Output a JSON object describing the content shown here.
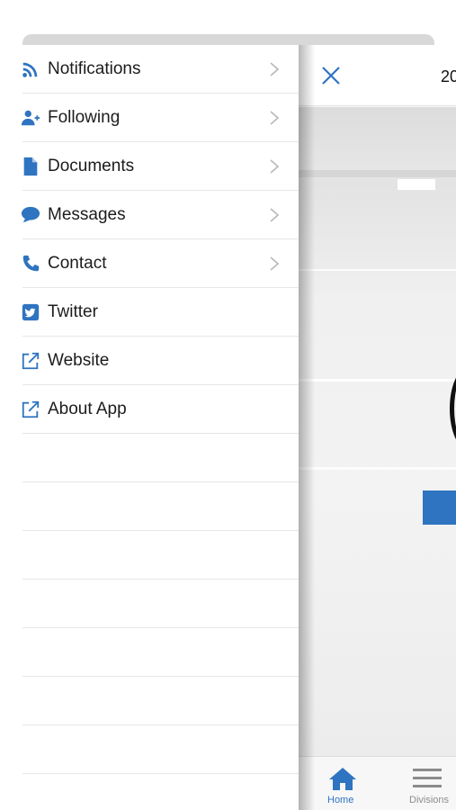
{
  "menu": {
    "items": [
      {
        "label": "Notifications",
        "icon": "rss-icon",
        "chevron": true
      },
      {
        "label": "Following",
        "icon": "user-plus-icon",
        "chevron": true
      },
      {
        "label": "Documents",
        "icon": "document-icon",
        "chevron": true
      },
      {
        "label": "Messages",
        "icon": "chat-bubble-icon",
        "chevron": true
      },
      {
        "label": "Contact",
        "icon": "phone-icon",
        "chevron": true
      },
      {
        "label": "Twitter",
        "icon": "twitter-icon",
        "chevron": false
      },
      {
        "label": "Website",
        "icon": "external-link-icon",
        "chevron": false
      },
      {
        "label": "About App",
        "icon": "external-link-icon",
        "chevron": false
      }
    ]
  },
  "main_panel": {
    "header_title": "20",
    "close_icon": "close-icon"
  },
  "tabbar": {
    "tabs": [
      {
        "label": "Home",
        "icon": "home-icon",
        "active": true
      },
      {
        "label": "Divisions",
        "icon": "menu-lines-icon",
        "active": false
      }
    ]
  },
  "colors": {
    "accent": "#2f74c0",
    "inactive": "#8c8c8c",
    "divider": "#e6e6e6"
  }
}
